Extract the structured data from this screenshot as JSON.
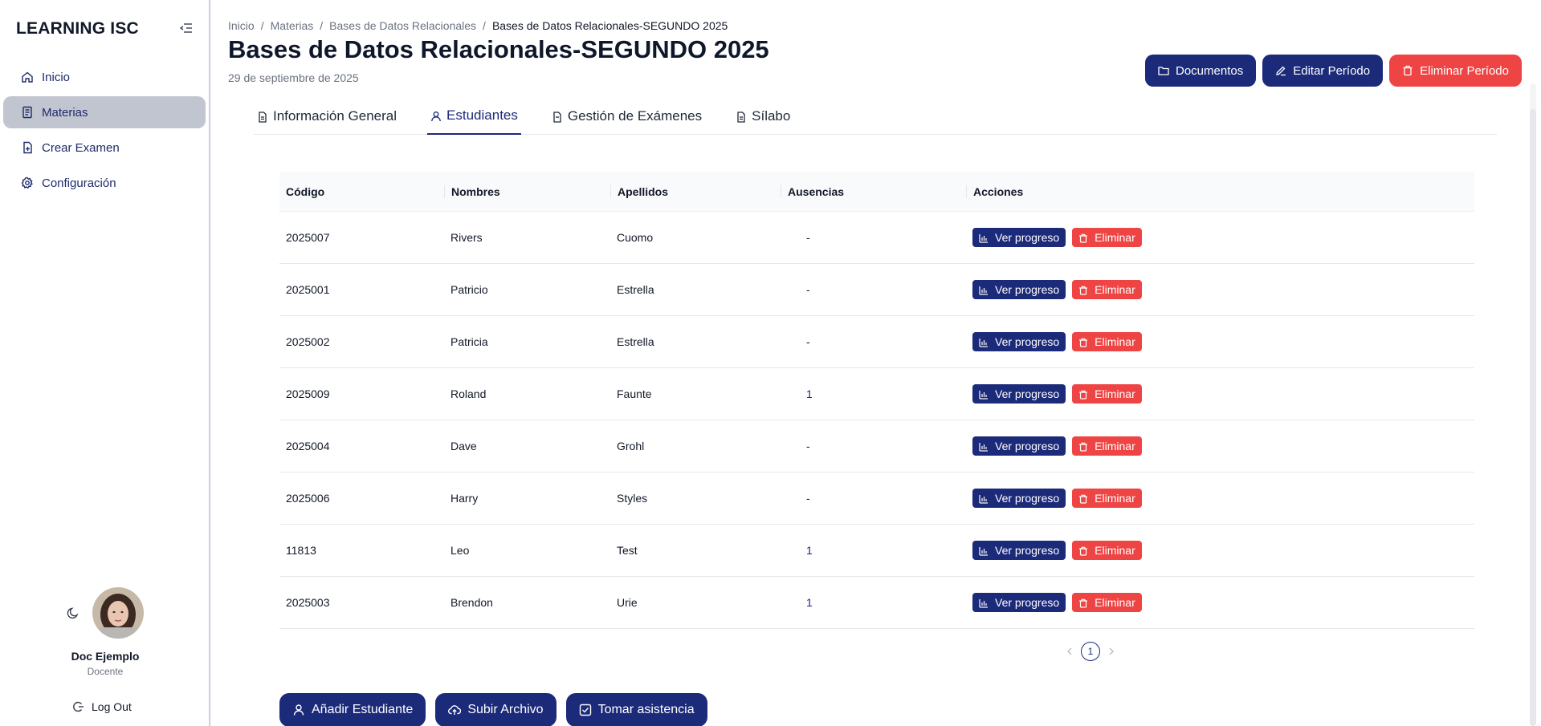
{
  "sidebar": {
    "brand": "LEARNING ISC",
    "items": [
      {
        "label": "Inicio",
        "icon": "home-icon"
      },
      {
        "label": "Materias",
        "icon": "book-icon"
      },
      {
        "label": "Crear Examen",
        "icon": "file-plus-icon"
      },
      {
        "label": "Configuración",
        "icon": "gear-icon"
      }
    ],
    "active_index": 1,
    "profile": {
      "name": "Doc Ejemplo",
      "role": "Docente"
    },
    "logout_label": "Log Out"
  },
  "header": {
    "breadcrumb": [
      "Inicio",
      "Materias",
      "Bases de Datos Relacionales",
      "Bases de Datos Relacionales-SEGUNDO 2025"
    ],
    "breadcrumb_separator": "/",
    "title": "Bases de Datos Relacionales-SEGUNDO 2025",
    "date": "29 de septiembre de 2025",
    "actions": {
      "documents": "Documentos",
      "edit_period": "Editar Período",
      "delete_period": "Eliminar Período"
    }
  },
  "tabs": [
    {
      "label": "Información General",
      "active": false
    },
    {
      "label": "Estudiantes",
      "active": true
    },
    {
      "label": "Gestión de Exámenes",
      "active": false
    },
    {
      "label": "Sílabo",
      "active": false
    }
  ],
  "table": {
    "columns": [
      "Código",
      "Nombres",
      "Apellidos",
      "Ausencias",
      "Acciones"
    ],
    "rows": [
      {
        "code": "2025007",
        "first": "Rivers",
        "last": "Cuomo",
        "absences": "-"
      },
      {
        "code": "2025001",
        "first": "Patricio",
        "last": "Estrella",
        "absences": "-"
      },
      {
        "code": "2025002",
        "first": "Patricia",
        "last": "Estrella",
        "absences": "-"
      },
      {
        "code": "2025009",
        "first": "Roland",
        "last": "Faunte",
        "absences": "1"
      },
      {
        "code": "2025004",
        "first": "Dave",
        "last": "Grohl",
        "absences": "-"
      },
      {
        "code": "2025006",
        "first": "Harry",
        "last": "Styles",
        "absences": "-"
      },
      {
        "code": "11813",
        "first": "Leo",
        "last": "Test",
        "absences": "1"
      },
      {
        "code": "2025003",
        "first": "Brendon",
        "last": "Urie",
        "absences": "1"
      }
    ],
    "row_actions": {
      "progress": "Ver progreso",
      "delete": "Eliminar"
    }
  },
  "pagination": {
    "current_page": "1"
  },
  "bottom_actions": {
    "add_student": "Añadir Estudiante",
    "upload_file": "Subir Archivo",
    "take_attendance": "Tomar asistencia"
  },
  "colors": {
    "primary": "#1c2a7a",
    "danger": "#ef4444",
    "active_nav": "#c1c5cf"
  }
}
